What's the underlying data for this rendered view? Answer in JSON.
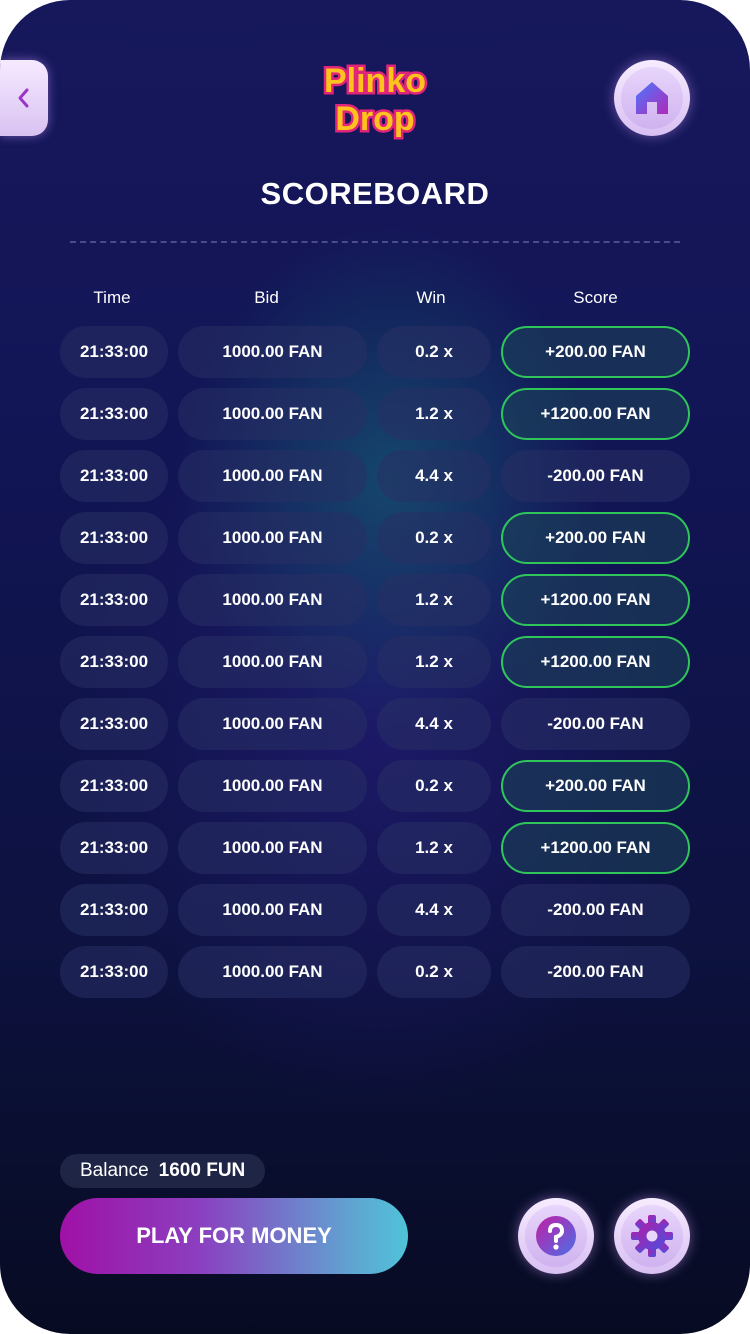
{
  "header": {
    "logo_line1": "Plinko",
    "logo_line2": "Drop",
    "title": "SCOREBOARD",
    "icons": {
      "back": "chevron-left-icon",
      "home": "home-icon",
      "help": "question-icon",
      "settings": "gear-icon"
    }
  },
  "table": {
    "headers": {
      "time": "Time",
      "bid": "Bid",
      "win": "Win",
      "score": "Score"
    },
    "rows": [
      {
        "time": "21:33:00",
        "bid": "1000.00 FAN",
        "win": "0.2 x",
        "score": "+200.00 FAN",
        "positive": true
      },
      {
        "time": "21:33:00",
        "bid": "1000.00 FAN",
        "win": "1.2 x",
        "score": "+1200.00 FAN",
        "positive": true
      },
      {
        "time": "21:33:00",
        "bid": "1000.00 FAN",
        "win": "4.4 x",
        "score": "-200.00 FAN",
        "positive": false
      },
      {
        "time": "21:33:00",
        "bid": "1000.00 FAN",
        "win": "0.2 x",
        "score": "+200.00 FAN",
        "positive": true
      },
      {
        "time": "21:33:00",
        "bid": "1000.00 FAN",
        "win": "1.2 x",
        "score": "+1200.00 FAN",
        "positive": true
      },
      {
        "time": "21:33:00",
        "bid": "1000.00 FAN",
        "win": "1.2 x",
        "score": "+1200.00 FAN",
        "positive": true
      },
      {
        "time": "21:33:00",
        "bid": "1000.00 FAN",
        "win": "4.4 x",
        "score": "-200.00 FAN",
        "positive": false
      },
      {
        "time": "21:33:00",
        "bid": "1000.00 FAN",
        "win": "0.2 x",
        "score": "+200.00 FAN",
        "positive": true
      },
      {
        "time": "21:33:00",
        "bid": "1000.00 FAN",
        "win": "1.2 x",
        "score": "+1200.00 FAN",
        "positive": true
      },
      {
        "time": "21:33:00",
        "bid": "1000.00 FAN",
        "win": "4.4 x",
        "score": "-200.00 FAN",
        "positive": false
      },
      {
        "time": "21:33:00",
        "bid": "1000.00 FAN",
        "win": "0.2 x",
        "score": "-200.00 FAN",
        "positive": false
      }
    ]
  },
  "footer": {
    "balance_label": "Balance",
    "balance_value": "1600 FUN",
    "play_label": "PLAY FOR MONEY"
  },
  "colors": {
    "accent_win_border": "#2fc55a",
    "logo_fill": "#ffc31e",
    "logo_outline": "#e0257a",
    "button_purple": "#9b35c8"
  }
}
